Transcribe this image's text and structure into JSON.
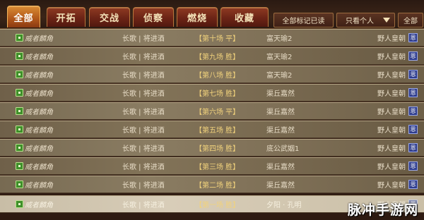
{
  "tabs": [
    {
      "label": "全部",
      "active": true
    },
    {
      "label": "开拓",
      "active": false
    },
    {
      "label": "交战",
      "active": false
    },
    {
      "label": "侦察",
      "active": false
    },
    {
      "label": "燃烧",
      "active": false
    },
    {
      "label": "收藏",
      "active": false
    }
  ],
  "controls": {
    "mark_all_read": "全部标记已读",
    "filter_select": "只看个人",
    "all_button": "全部"
  },
  "rows": [
    {
      "rank": "威者麟角",
      "place": "长歌 | 将进酒",
      "battle": "【第十场 平】",
      "opponent": "富天瑜2",
      "type": "野人皇朝",
      "badge": "恩"
    },
    {
      "rank": "威者麟角",
      "place": "长歌 | 将进酒",
      "battle": "【第九场 胜】",
      "opponent": "富天瑜2",
      "type": "野人皇朝",
      "badge": "恩"
    },
    {
      "rank": "威者麟角",
      "place": "长歌 | 将进酒",
      "battle": "【第八场 胜】",
      "opponent": "富天瑜2",
      "type": "野人皇朝",
      "badge": "恩"
    },
    {
      "rank": "威者麟角",
      "place": "长歌 | 将进酒",
      "battle": "【第七场 胜】",
      "opponent": "渠丘嘉然",
      "type": "野人皇朝",
      "badge": "恩"
    },
    {
      "rank": "威者麟角",
      "place": "长歌 | 将进酒",
      "battle": "【第六场 平】",
      "opponent": "渠丘嘉然",
      "type": "野人皇朝",
      "badge": "恩"
    },
    {
      "rank": "威者麟角",
      "place": "长歌 | 将进酒",
      "battle": "【第五场 胜】",
      "opponent": "渠丘嘉然",
      "type": "野人皇朝",
      "badge": "恩"
    },
    {
      "rank": "威者麟角",
      "place": "长歌 | 将进酒",
      "battle": "【第四场 胜】",
      "opponent": "底公武姻1",
      "type": "野人皇朝",
      "badge": "恩"
    },
    {
      "rank": "威者麟角",
      "place": "长歌 | 将进酒",
      "battle": "【第三场 胜】",
      "opponent": "渠丘嘉然",
      "type": "野人皇朝",
      "badge": "恩"
    },
    {
      "rank": "威者麟角",
      "place": "长歌 | 将进酒",
      "battle": "【第二场 胜】",
      "opponent": "渠丘嘉然",
      "type": "野人皇朝",
      "badge": "恩"
    },
    {
      "rank": "威者麟角",
      "place": "长歌 | 将进酒",
      "battle": "【第一场 胜】",
      "opponent": "夕阳 · 孔明",
      "type": "野人皇朝",
      "badge": "恩"
    }
  ],
  "watermark": "脉冲手游网",
  "colors": {
    "tab_active": "#b0561a",
    "tab_inactive": "#6b2416",
    "battle_text": "#f1d27c",
    "badge": "#2f3d8e"
  }
}
